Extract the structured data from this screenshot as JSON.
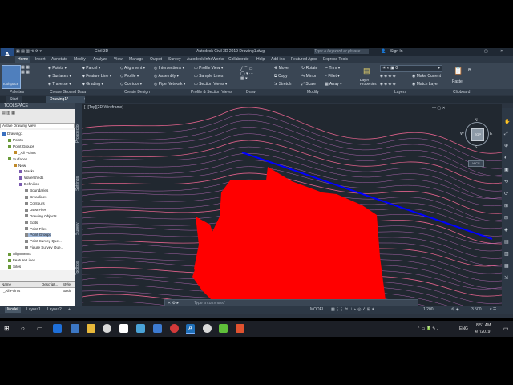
{
  "window": {
    "app_icon": "A",
    "workspace": "Civil 3D",
    "title": "Autodesk Civil 3D 2019    Drawing1.dwg",
    "search_placeholder": "Type a keyword or phrase",
    "signin": "Sign In"
  },
  "ribbon_tabs": [
    "Home",
    "Insert",
    "Annotate",
    "Modify",
    "Analyze",
    "View",
    "Manage",
    "Output",
    "Survey",
    "Autodesk InfraWorks",
    "Collaborate",
    "Help",
    "Add-ins",
    "Featured Apps",
    "Express Tools"
  ],
  "ribbon": {
    "toolspace": "Toolspace",
    "col1": [
      "Points",
      "Surfaces",
      "Traverse"
    ],
    "col2": [
      "Parcel",
      "Feature Line",
      "Grading"
    ],
    "col3": [
      "Alignment",
      "Profile",
      "Corridor"
    ],
    "col4": [
      "Intersections",
      "Assembly",
      "Pipe Network"
    ],
    "col5": [
      "Profile View",
      "Sample Lines",
      "Section Views"
    ],
    "modify1": [
      "Move",
      "Copy",
      "Stretch"
    ],
    "modify2": [
      "Rotate",
      "Mirror",
      "Scale"
    ],
    "modify3": [
      "Trim",
      "Fillet",
      "Array"
    ],
    "layer_props": "Layer Properties",
    "layer_value": "0",
    "layers_right": [
      "Make Current",
      "Match Layer"
    ],
    "paste": "Paste"
  },
  "ribbon_panels": [
    "Palettes",
    "Create Ground Data",
    "Create Design",
    "Profile & Section Views",
    "Draw",
    "Modify",
    "Layers",
    "Clipboard"
  ],
  "doc_tabs": [
    "Start",
    "Drawing1*"
  ],
  "toolspace_panel": {
    "header": "TOOLSPACE",
    "view_label": "Active Drawing View",
    "tree": [
      {
        "label": "Drawing1",
        "indent": 0
      },
      {
        "label": "Points",
        "indent": 1
      },
      {
        "label": "Point Groups",
        "indent": 1
      },
      {
        "label": "_All Points",
        "indent": 2
      },
      {
        "label": "Surfaces",
        "indent": 1
      },
      {
        "label": "New",
        "indent": 2
      },
      {
        "label": "Masks",
        "indent": 3
      },
      {
        "label": "Watersheds",
        "indent": 3
      },
      {
        "label": "Definition",
        "indent": 3
      },
      {
        "label": "Boundaries",
        "indent": 4
      },
      {
        "label": "Breaklines",
        "indent": 4
      },
      {
        "label": "Contours",
        "indent": 4
      },
      {
        "label": "DEM Files",
        "indent": 4
      },
      {
        "label": "Drawing Objects",
        "indent": 4
      },
      {
        "label": "Edits",
        "indent": 4
      },
      {
        "label": "Point Files",
        "indent": 4
      },
      {
        "label": "Point Groups",
        "indent": 4,
        "selected": true
      },
      {
        "label": "Point Survey Que...",
        "indent": 4
      },
      {
        "label": "Figure Survey Que...",
        "indent": 4
      },
      {
        "label": "Alignments",
        "indent": 1
      },
      {
        "label": "Feature Lines",
        "indent": 1
      },
      {
        "label": "Sites",
        "indent": 1
      }
    ],
    "list_headers": [
      "Name",
      "Descript...",
      "Style"
    ],
    "list_rows": [
      [
        "_All Points",
        "",
        "Basic"
      ]
    ]
  },
  "side_tabs": [
    "Prospector",
    "Settings",
    "Survey",
    "Toolbox"
  ],
  "viewport": {
    "label": "[-][Top][2D Wireframe]",
    "cmd_placeholder": "Type a command",
    "compass": {
      "N": "N",
      "S": "S",
      "E": "E",
      "W": "W",
      "top": "TOP"
    },
    "wcs": "WCS"
  },
  "layout_tabs": [
    "Model",
    "Layout1",
    "Layout2",
    "+"
  ],
  "status": {
    "mode": "MODEL",
    "scale": "1:200",
    "value": "3.500"
  },
  "taskbar": {
    "time": "8:51 AM",
    "date": "4/7/2019",
    "lang": "ENG"
  },
  "colors": {
    "surface_fill": "#ff0000",
    "breakline": "#0000ff",
    "contour_major": "#ff6b9a",
    "contour_minor": "#c070c0"
  }
}
